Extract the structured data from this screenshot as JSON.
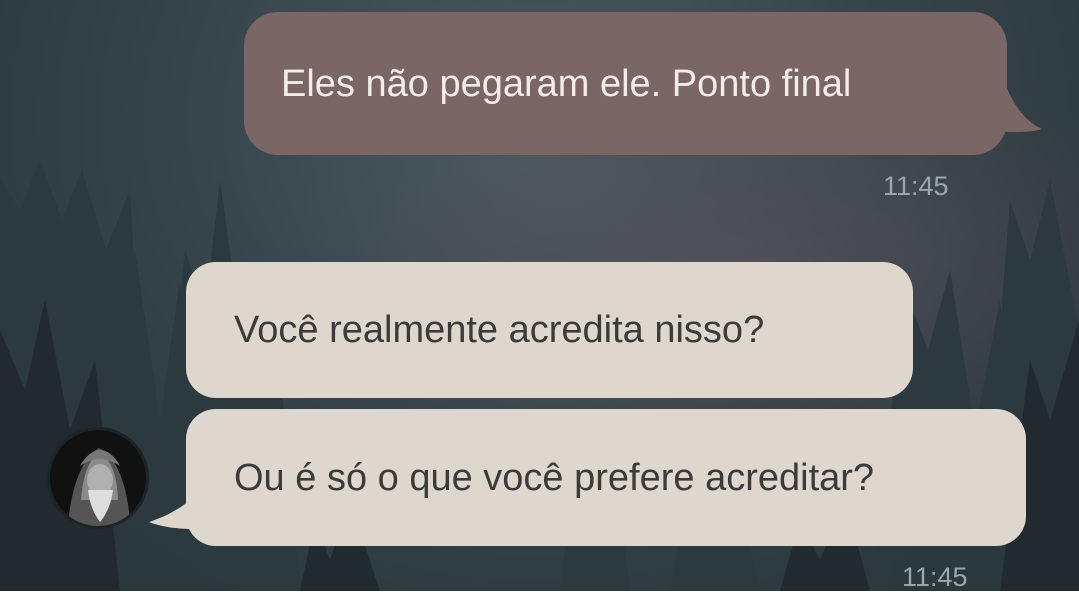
{
  "messages": [
    {
      "direction": "outgoing",
      "text": "Eles não pegaram ele. Ponto final",
      "time": "11:45"
    },
    {
      "direction": "incoming",
      "text": "Você realmente acredita nisso?"
    },
    {
      "direction": "incoming",
      "text": "Ou é só o que você prefere acreditar?",
      "time": "11:45"
    }
  ],
  "colors": {
    "outgoing_bubble": "#7a6664",
    "incoming_bubble": "#ded7cd",
    "timestamp": "#9aa8ad",
    "background": "#35434a"
  },
  "icons": {
    "avatar": "hooded-person-photo"
  }
}
